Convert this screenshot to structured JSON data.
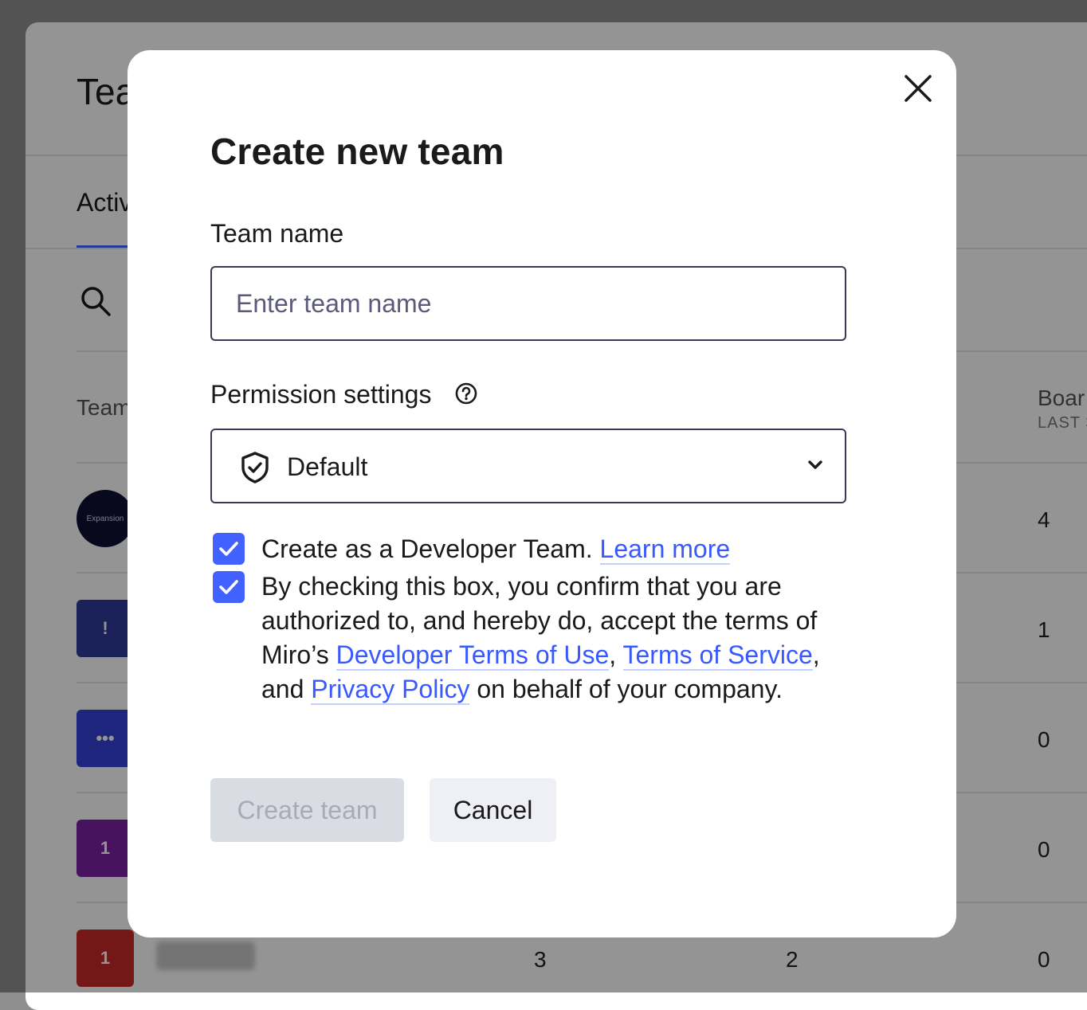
{
  "background": {
    "page_title": "Tea",
    "active_tab": "Activ",
    "columns": {
      "team": "Team",
      "boards": "Boar",
      "boards_sub": "LAST 3"
    },
    "rows": [
      {
        "badge": "Expansion",
        "badge_color": "#0e1033",
        "col3": "",
        "col4": "",
        "boards": "4"
      },
      {
        "badge": "!",
        "badge_color": "#2f3a99",
        "col3": "",
        "col4": "",
        "boards": "1"
      },
      {
        "badge": "•••",
        "badge_color": "#3342d6",
        "col3": "",
        "col4": "",
        "boards": "0"
      },
      {
        "badge": "1",
        "badge_color": "#7b1fa2",
        "col3": "",
        "col4": "",
        "boards": "0"
      },
      {
        "badge": "1",
        "badge_color": "#c62828",
        "col3": "3",
        "col4": "2",
        "boards": "0"
      }
    ]
  },
  "modal": {
    "title": "Create new team",
    "team_name_label": "Team name",
    "team_name_placeholder": "Enter team name",
    "team_name_value": "",
    "permission_label": "Permission settings",
    "permission_value": "Default",
    "developer_checkbox": {
      "checked": true,
      "text": "Create as a Developer Team.",
      "link": "Learn more"
    },
    "terms_checkbox": {
      "checked": true,
      "text_1": "By checking this box, you confirm that you are authorized to, and hereby do, accept the terms of Miro’s",
      "link_dev_terms": "Developer Terms of Use",
      "sep_1": ",",
      "link_tos": "Terms of Service",
      "sep_2": ", and",
      "link_privacy": "Privacy Policy",
      "text_2": "on behalf of your company."
    },
    "create_button": "Create team",
    "cancel_button": "Cancel"
  },
  "colors": {
    "accent": "#4262ff",
    "link": "#3859ff",
    "disabled_button_bg": "#d9dce3",
    "disabled_button_text": "#a6abb6"
  },
  "icons": [
    "close-icon",
    "help-icon",
    "shield-check-icon",
    "chevron-down-icon",
    "checkmark-icon",
    "search-icon"
  ]
}
